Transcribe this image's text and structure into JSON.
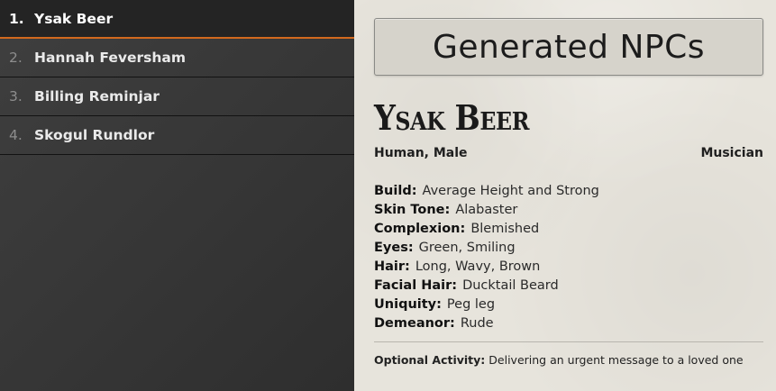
{
  "sidebar": {
    "items": [
      {
        "number": "1.",
        "name": "Ysak Beer",
        "active": true
      },
      {
        "number": "2.",
        "name": "Hannah Feversham",
        "active": false
      },
      {
        "number": "3.",
        "name": "Billing Reminjar",
        "active": false
      },
      {
        "number": "4.",
        "name": "Skogul Rundlor",
        "active": false
      }
    ]
  },
  "main": {
    "header_title": "Generated NPCs",
    "npc": {
      "name": "Ysak Beer",
      "race_gender": "Human, Male",
      "occupation": "Musician",
      "attributes": [
        {
          "label": "Build:",
          "value": "Average Height and Strong"
        },
        {
          "label": "Skin Tone:",
          "value": "Alabaster"
        },
        {
          "label": "Complexion:",
          "value": "Blemished"
        },
        {
          "label": "Eyes:",
          "value": "Green, Smiling"
        },
        {
          "label": "Hair:",
          "value": "Long, Wavy, Brown"
        },
        {
          "label": "Facial Hair:",
          "value": "Ducktail Beard"
        },
        {
          "label": "Uniquity:",
          "value": "Peg leg"
        },
        {
          "label": "Demeanor:",
          "value": "Rude"
        }
      ],
      "optional_activity_label": "Optional Activity:",
      "optional_activity": "Delivering an urgent message to a loved one"
    }
  },
  "colors": {
    "sidebar_bg": "#3b3b3b",
    "active_underline": "#d2691e",
    "parchment_bg": "#e7e4dc"
  }
}
